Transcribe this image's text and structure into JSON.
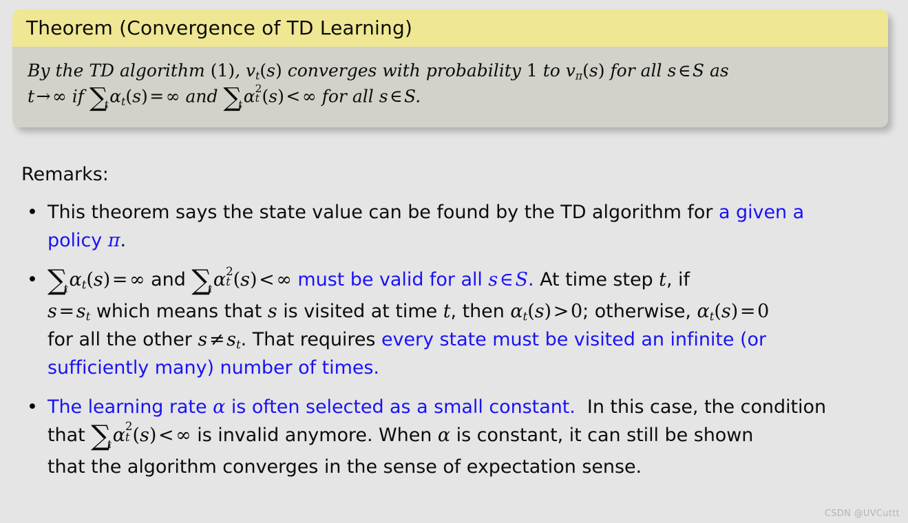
{
  "slide": {
    "background_color": "#e5e5e5",
    "text_color": "#0c0c0c",
    "highlight_color": "#1a12f5"
  },
  "theorem": {
    "header_color": "#efe793",
    "body_color": "#d2d2ca",
    "title": "Theorem (Convergence of TD Learning)",
    "body_plain": "By the TD algorithm (1), v_t(s) converges with probability 1 to v_pi(s) for all s ∈ S as t → ∞ if ∑_t α_t(s) = ∞ and ∑_t α_t^2(s) < ∞ for all s ∈ S.",
    "line1": {
      "seg1": "By the TD algorithm",
      "seg2": "(1)",
      "seg3": ",",
      "v": "v",
      "v_sub": "t",
      "paren_open": "(",
      "s": "s",
      "paren_close": ")",
      "seg4": "converges with probability",
      "one": "1",
      "seg5": "to",
      "v2": "v",
      "v2_sub": "π",
      "seg6": "for all",
      "s2": "s",
      "in": "∈",
      "setS": "S",
      "seg7": "as"
    },
    "line2": {
      "t": "t",
      "arrow": "→",
      "infinity": "∞",
      "if": "if",
      "sum": "∑",
      "sum_sub": "t",
      "alpha": "α",
      "alpha_sub": "t",
      "alpha_sup": "2",
      "eq": "=",
      "and": "and",
      "lt": "<",
      "forall": "for all",
      "in": "∈",
      "setS": "S",
      "period": "."
    }
  },
  "remarks": {
    "heading": "Remarks:",
    "bullet_glyph": "•",
    "items": [
      {
        "plain": "This theorem says the state value can be found by the TD algorithm for a given a policy π.",
        "line1": {
          "black": "This theorem says the state value can be found by the TD algorithm for",
          "blue": "a given a"
        },
        "line2": {
          "blue": "policy",
          "blue_pi": "π",
          "black": "."
        }
      },
      {
        "plain": "∑_t α_t(s) = ∞ and ∑_t α_t^2(s) < ∞ must be valid for all s ∈ S. At time step t, if s = s_t which means that s is visited at time t, then α_t(s) > 0; otherwise, α_t(s) = 0 for all the other s ≠ s_t. That requires every state must be visited an infinite (or sufficiently many) number of times.",
        "line1": {
          "blue_tail": "must be valid for all",
          "blue_s": "s",
          "blue_in": "∈",
          "blue_setS": "S",
          "blue_period": ".",
          "black_tail": "At time step",
          "black_t": "t",
          "black_if": ", if"
        },
        "line2": {
          "s": "s",
          "eq": "=",
          "s_sub": "t",
          "mid": "which means that",
          "s2": "s",
          "mid2": "is visited at time",
          "t": "t",
          "then": ", then",
          "alpha": "α",
          "gt": ">",
          "zero": "0",
          "otherwise": "; otherwise,",
          "eq2": "=",
          "zero2": "0"
        },
        "line3": {
          "lead": "for all the other",
          "s": "s",
          "neq": "≠",
          "s_sub": "t",
          "mid": ". That requires",
          "blue": "every state must be visited an infinite (or"
        },
        "line4": {
          "blue": "sufficiently many) number of times."
        }
      },
      {
        "plain": "The learning rate α is often selected as a small constant. In this case, the condition that ∑_t α_t^2(s) < ∞ is invalid anymore. When α is constant, it can still be shown that the algorithm converges in the sense of expectation sense.",
        "line1": {
          "blue_a": "The learning rate",
          "blue_alpha": "α",
          "blue_b": "is often selected as a small constant.",
          "black": "In this case, the condition"
        },
        "line2": {
          "that": "that",
          "sum": "∑",
          "sum_sub": "t",
          "alpha": "α",
          "alpha_sub": "t",
          "alpha_sup": "2",
          "lt": "<",
          "infinity": "∞",
          "mid": "is invalid anymore. When",
          "alpha2": "α",
          "tail": "is constant, it can still be shown"
        },
        "line3": {
          "text": "that the algorithm converges in the sense of expectation sense."
        }
      }
    ]
  },
  "watermark": {
    "text": "CSDN @UVCuttt"
  }
}
